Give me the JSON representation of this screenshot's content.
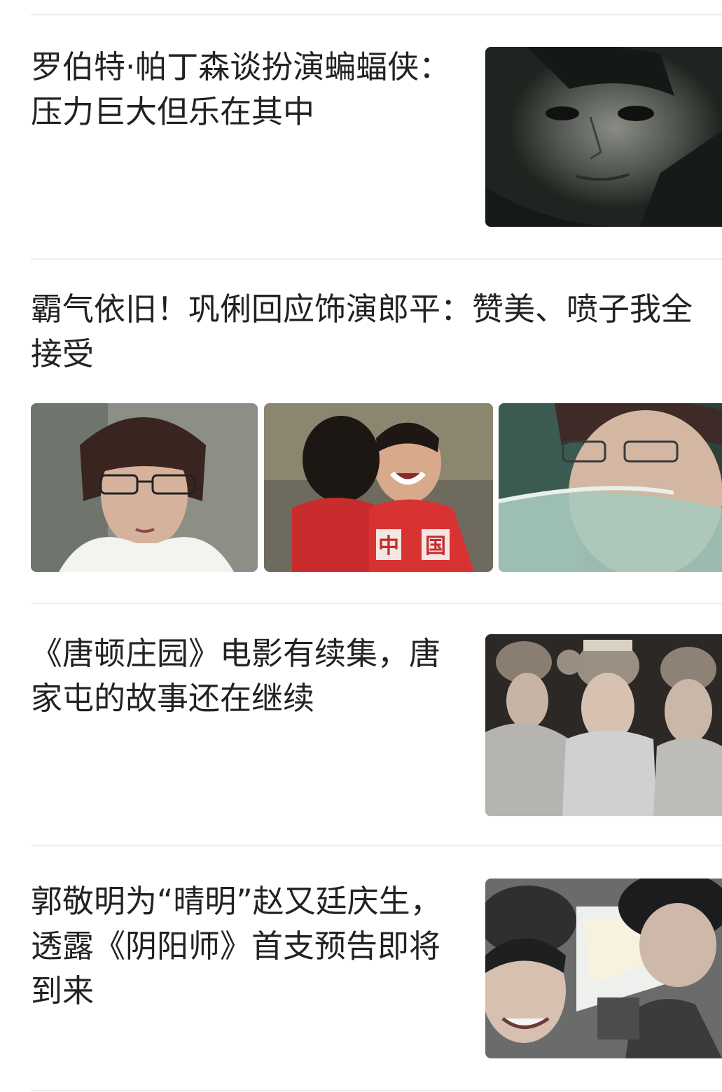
{
  "articles": [
    {
      "title": "罗伯特·帕丁森谈扮演蝙蝠侠：压力巨大但乐在其中",
      "image": "dark-portrait-photo"
    },
    {
      "title": "霸气依旧！巩俐回应饰演郎平：赞美、喷子我全接受",
      "images": [
        "woman-with-glasses-photo",
        "smiling-volleyball-player-photo",
        "woman-with-glasses-closeup-photo"
      ],
      "jersey_text": "中 国"
    },
    {
      "title": "《唐顿庄园》电影有续集，唐家屯的故事还在继续",
      "image": "period-drama-women-photo"
    },
    {
      "title": "郭敬明为“晴明”赵又廷庆生，透露《阴阳师》首支预告即将到来",
      "image": "behind-the-scenes-selfie-photo"
    }
  ]
}
